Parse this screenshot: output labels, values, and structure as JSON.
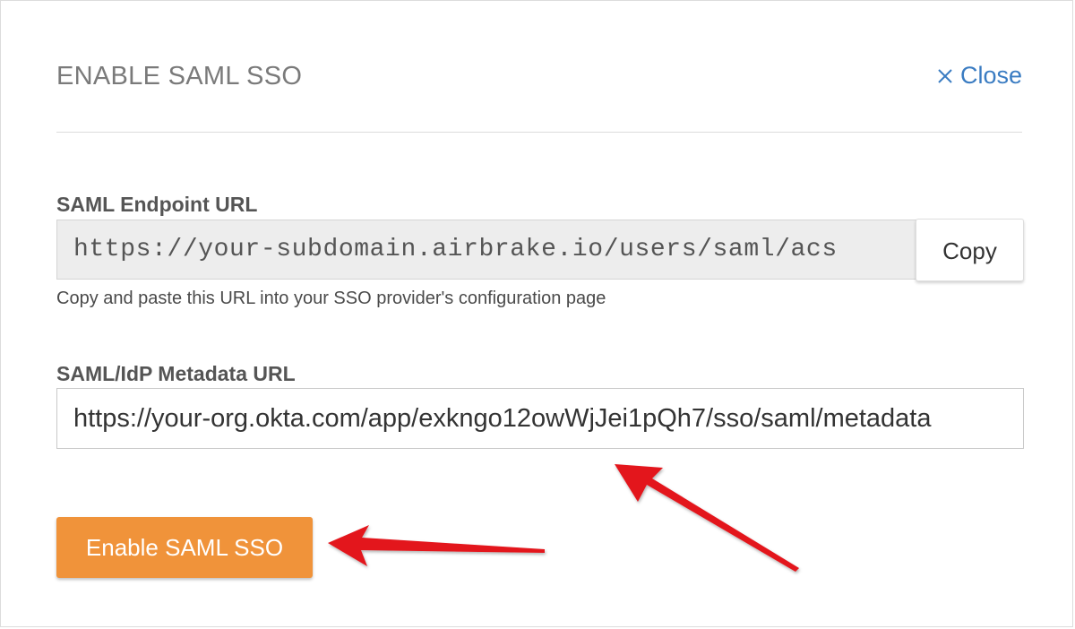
{
  "modal": {
    "title": "ENABLE SAML SSO",
    "close_label": "Close"
  },
  "endpoint": {
    "label": "SAML Endpoint URL",
    "value": "https://your-subdomain.airbrake.io/users/saml/acs",
    "copy_label": "Copy",
    "help": "Copy and paste this URL into your SSO provider's configuration page"
  },
  "metadata": {
    "label": "SAML/IdP Metadata URL",
    "value": "https://your-org.okta.com/app/exkngo12owWjJei1pQh7/sso/saml/metadata"
  },
  "submit": {
    "label": "Enable SAML SSO"
  },
  "colors": {
    "accent": "#f0933a",
    "link": "#3a7cc2",
    "annotation_arrow": "#e3131b"
  },
  "icons": {
    "close": "close-icon"
  }
}
